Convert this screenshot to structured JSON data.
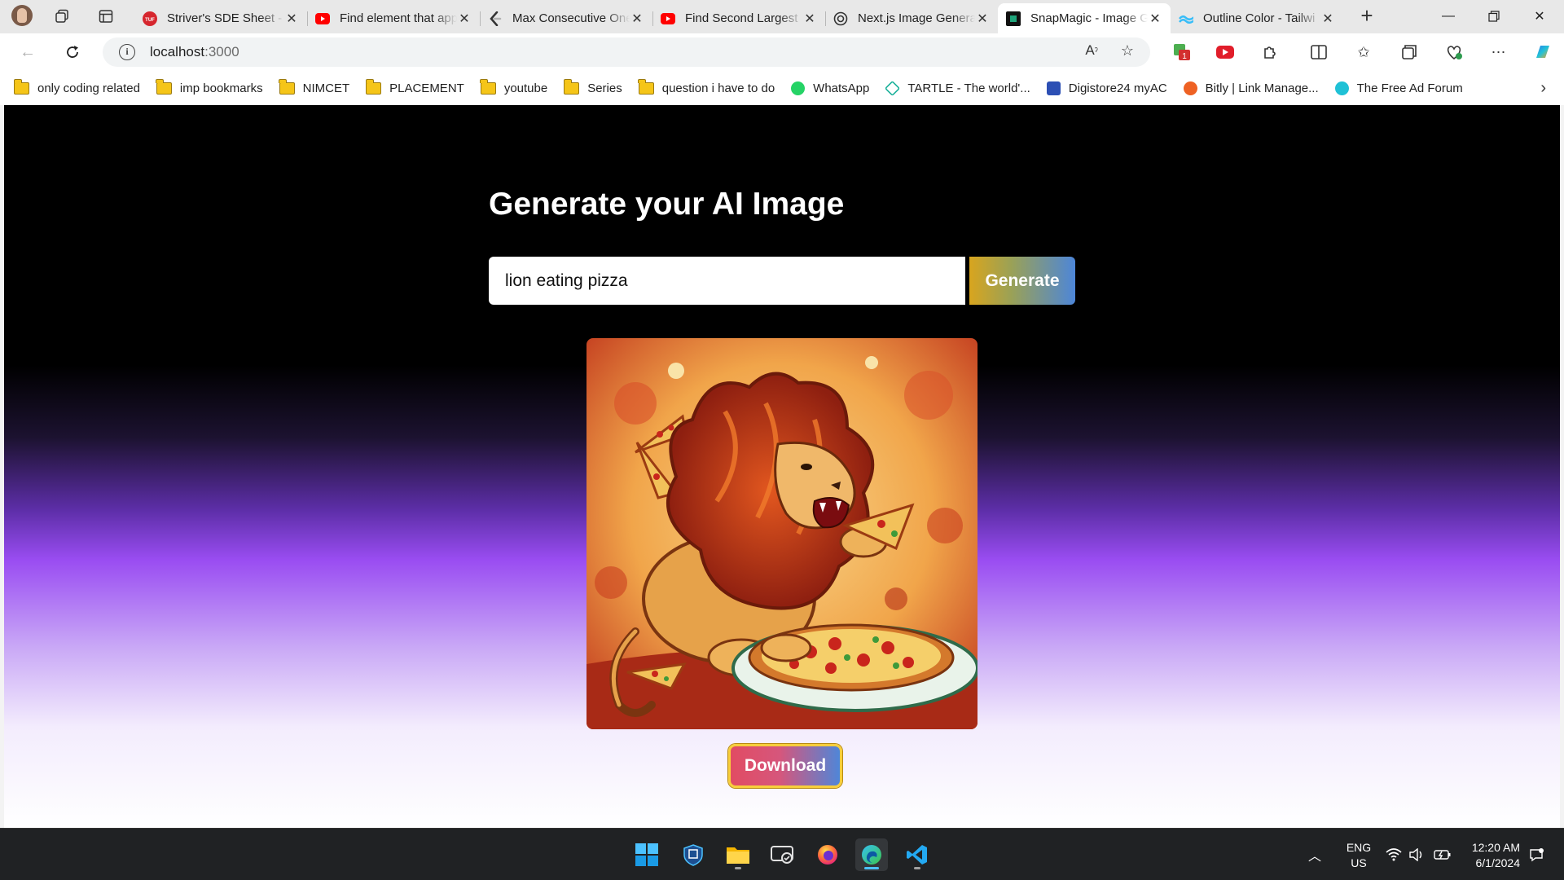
{
  "browser": {
    "tabs": [
      {
        "title": "Striver's SDE Sheet - T",
        "icon": "tuf-icon"
      },
      {
        "title": "Find element that app",
        "icon": "youtube-icon"
      },
      {
        "title": "Max Consecutive Ones",
        "icon": "leetcode-icon"
      },
      {
        "title": "Find Second Largest E",
        "icon": "youtube-icon"
      },
      {
        "title": "Next.js Image Generat",
        "icon": "openai-icon"
      },
      {
        "title": "SnapMagic - Image Ge",
        "icon": "snapmagic-icon"
      },
      {
        "title": "Outline Color - Tailwi",
        "icon": "tailwind-icon"
      }
    ],
    "active_tab_index": 5,
    "url_host": "localhost",
    "url_port": ":3000",
    "bookmarks": [
      {
        "label": "only coding  related",
        "type": "folder"
      },
      {
        "label": "imp bookmarks",
        "type": "folder"
      },
      {
        "label": "NIMCET",
        "type": "folder"
      },
      {
        "label": "PLACEMENT",
        "type": "folder"
      },
      {
        "label": "youtube",
        "type": "folder"
      },
      {
        "label": "Series",
        "type": "folder"
      },
      {
        "label": "question i have to do",
        "type": "folder"
      },
      {
        "label": "WhatsApp",
        "type": "whatsapp-icon"
      },
      {
        "label": "TARTLE - The world'...",
        "type": "tartle-icon"
      },
      {
        "label": "Digistore24 myAC",
        "type": "digistore-icon"
      },
      {
        "label": "Bitly | Link Manage...",
        "type": "bitly-icon"
      },
      {
        "label": "The Free Ad Forum",
        "type": "adforum-icon"
      }
    ]
  },
  "page": {
    "heading": "Generate your AI Image",
    "prompt_value": "lion eating pizza",
    "generate_label": "Generate",
    "download_label": "Download",
    "image_subject": "lion eating pizza illustration"
  },
  "taskbar": {
    "language": "ENG",
    "region": "US",
    "time": "12:20 AM",
    "date": "6/1/2024"
  },
  "colors": {
    "generate_gradient": [
      "#d8a51e",
      "#4d86d8"
    ],
    "download_gradient": [
      "#e14c63",
      "#4f86d8"
    ],
    "download_border": "#f7ce3c",
    "page_gradient": [
      "#000000",
      "#9a4df2",
      "#ffffff"
    ]
  }
}
